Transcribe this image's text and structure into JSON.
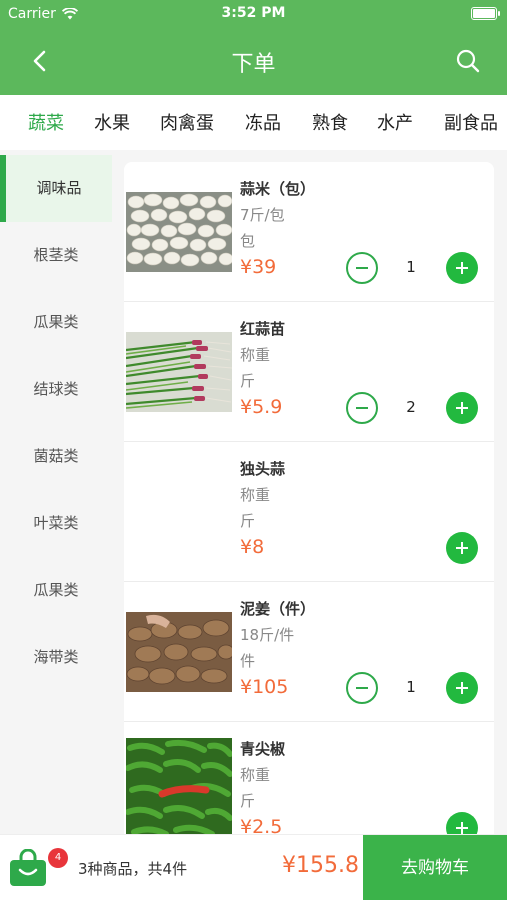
{
  "status_bar": {
    "carrier": "Carrier",
    "time": "3:52 PM"
  },
  "nav": {
    "title": "下单"
  },
  "categories": [
    "蔬菜",
    "水果",
    "肉禽蛋",
    "冻品",
    "熟食",
    "水产",
    "副食品"
  ],
  "subcategories": [
    "调味品",
    "根茎类",
    "瓜果类",
    "结球类",
    "菌菇类",
    "叶菜类",
    "瓜果类",
    "海带类"
  ],
  "products": [
    {
      "name": "蒜米（包）",
      "spec": "7斤/包",
      "unit": "包",
      "price": "¥39",
      "qty": "1"
    },
    {
      "name": "红蒜苗",
      "spec": "称重",
      "unit": "斤",
      "price": "¥5.9",
      "qty": "2"
    },
    {
      "name": "独头蒜",
      "spec": "称重",
      "unit": "斤",
      "price": "¥8",
      "qty": ""
    },
    {
      "name": "泥姜（件）",
      "spec": "18斤/件",
      "unit": "件",
      "price": "¥105",
      "qty": "1"
    },
    {
      "name": "青尖椒",
      "spec": "称重",
      "unit": "斤",
      "price": "¥2.5",
      "qty": ""
    }
  ],
  "cart": {
    "badge": "4",
    "summary": "3种商品，共4件",
    "total": "¥155.8",
    "checkout_label": "去购物车"
  },
  "colors": {
    "brand_green": "#5cb85c",
    "accent_green": "#2ea94a",
    "price_orange": "#f26b3a",
    "badge_red": "#e8353b"
  }
}
